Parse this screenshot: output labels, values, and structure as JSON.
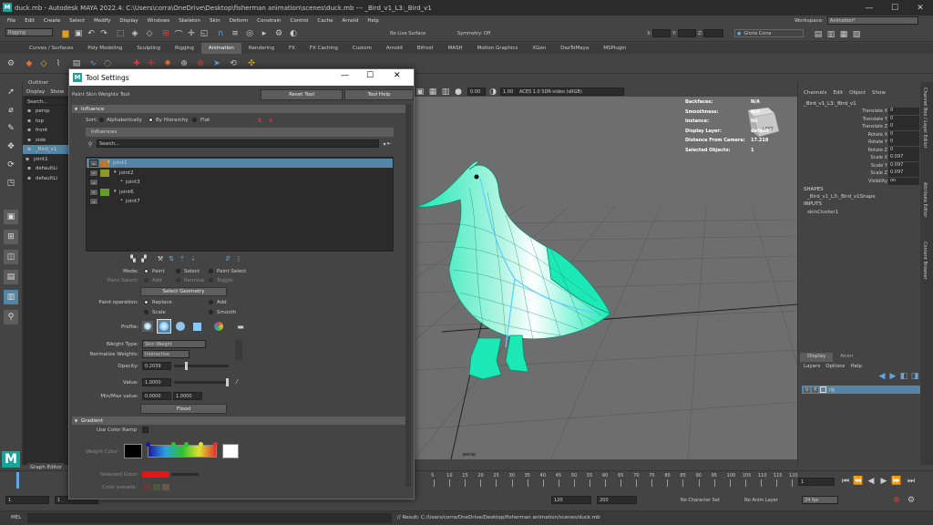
{
  "window": {
    "title": "duck.mb - Autodesk MAYA 2022.4: C:\\Users\\corra\\OneDrive\\Desktop\\fisherman animation\\scenes\\duck.mb  ---  _Bird_v1_L3:_Bird_v1",
    "minimize": "—",
    "maximize": "☐",
    "close": "✕"
  },
  "menubar": [
    "File",
    "Edit",
    "Create",
    "Select",
    "Modify",
    "Display",
    "Windows",
    "Skeleton",
    "Skin",
    "Deform",
    "Constrain",
    "Control",
    "Cache",
    "Arnold",
    "Help"
  ],
  "workspace": {
    "label": "Workspace:",
    "value": "Animation*"
  },
  "statusline": {
    "menuset": "Rigging",
    "live_surface": "No Live Surface",
    "symmetry": "Symmetry: Off",
    "coord_x": "X:",
    "coord_y": "Y:",
    "coord_z": "Z:",
    "user": "Gloria Corra"
  },
  "shelf_tabs": [
    "Curves / Surfaces",
    "Poly Modeling",
    "Sculpting",
    "Rigging",
    "Animation",
    "Rendering",
    "FX",
    "FX Caching",
    "Custom",
    "Arnold",
    "Bifrost",
    "MASH",
    "Motion Graphics",
    "XGen",
    "DazToMaya",
    "MSPlugin"
  ],
  "active_shelf_tab": "Animation",
  "outliner": {
    "title": "Outliner",
    "menu": [
      "Display",
      "Show"
    ],
    "search": "Search...",
    "items": [
      "persp",
      "top",
      "front",
      "side",
      "_Bird_v1",
      "joint1",
      "defaultLi",
      "defaultLi"
    ]
  },
  "tool_settings": {
    "title": "Tool Settings",
    "tool_name": "Paint Skin Weights Tool",
    "reset_tool": "Reset Tool",
    "tool_help": "Tool Help",
    "influence": {
      "header": "Influence",
      "sort_label": "Sort:",
      "sort_options": [
        "Alphabetically",
        "By Hierarchy",
        "Flat"
      ],
      "sort_selected": "By Hierarchy",
      "influences_header": "Influences",
      "search_placeholder": "Search...",
      "joints": [
        {
          "name": "joint1",
          "indent": 1,
          "color": "#b87a30",
          "selected": true,
          "expand": "▾"
        },
        {
          "name": "joint2",
          "indent": 2,
          "color": "#8a9a2a",
          "selected": false,
          "expand": "▾"
        },
        {
          "name": "joint3",
          "indent": 3,
          "color": "",
          "selected": false,
          "expand": "•"
        },
        {
          "name": "joint6",
          "indent": 2,
          "color": "#6a9a2a",
          "selected": false,
          "expand": "▾"
        },
        {
          "name": "joint7",
          "indent": 3,
          "color": "",
          "selected": false,
          "expand": "•"
        }
      ]
    },
    "mode": {
      "label": "Mode:",
      "options": [
        "Paint",
        "Select",
        "Paint Select"
      ],
      "selected": "Paint"
    },
    "paint_select": {
      "label": "Paint Select:",
      "options": [
        "Add",
        "Remove",
        "Toggle"
      ]
    },
    "select_geometry": "Select Geometry",
    "paint_operation": {
      "label": "Paint operation:",
      "options": [
        "Replace",
        "Add",
        "Scale",
        "Smooth"
      ],
      "selected": "Replace"
    },
    "profile_label": "Profile:",
    "weight_type": {
      "label": "Weight Type:",
      "value": "Skin Weight"
    },
    "normalize_weights": {
      "label": "Normalize Weights:",
      "value": "Interactive"
    },
    "opacity": {
      "label": "Opacity:",
      "value": "0.2039",
      "fraction": 0.2039
    },
    "value": {
      "label": "Value:",
      "value": "1.0000",
      "fraction": 1.0
    },
    "minmax": {
      "label": "Min/Max value:",
      "min": "0.0000",
      "max": "1.0000"
    },
    "flood": "Flood",
    "gradient": {
      "header": "Gradient",
      "use_color_ramp": "Use Color Ramp",
      "weight_color": "Weight Color:",
      "selected_color": "Selected Color:",
      "color_presets": "Color presets:"
    }
  },
  "panel": {
    "zoom": "0.00",
    "scale": "1.00",
    "colorspace": "ACES 1.0 SDR-video (sRGB)"
  },
  "hud": [
    {
      "label": "Backfaces:",
      "value": "N/A"
    },
    {
      "label": "Smoothness:",
      "value": "N/A"
    },
    {
      "label": "Instance:",
      "value": "No"
    },
    {
      "label": "Display Layer:",
      "value": "default"
    },
    {
      "label": "Distance From Camera:",
      "value": "17.218"
    },
    {
      "label": "Selected Objects:",
      "value": "1"
    }
  ],
  "viewcube_label": "LEFT",
  "camera_label": "persp",
  "channel_box": {
    "tabs": [
      "Channels",
      "Edit",
      "Object",
      "Show"
    ],
    "object": "_Bird_v1_L3:_Bird_v1",
    "attrs": [
      {
        "name": "Translate X",
        "value": "0"
      },
      {
        "name": "Translate Y",
        "value": "0"
      },
      {
        "name": "Translate Z",
        "value": "0"
      },
      {
        "name": "Rotate X",
        "value": "0"
      },
      {
        "name": "Rotate Y",
        "value": "0"
      },
      {
        "name": "Rotate Z",
        "value": "0"
      },
      {
        "name": "Scale X",
        "value": "0.097"
      },
      {
        "name": "Scale Y",
        "value": "0.097"
      },
      {
        "name": "Scale Z",
        "value": "0.097"
      },
      {
        "name": "Visibility",
        "value": "on"
      }
    ],
    "shapes_header": "SHAPES",
    "shape": "_Bird_v1_L3:_Bird_v1Shape",
    "inputs_header": "INPUTS",
    "input": "skinCluster1"
  },
  "layer_editor": {
    "tabs": [
      "Display",
      "Anim"
    ],
    "menu": [
      "Layers",
      "Options",
      "Help"
    ],
    "layer": {
      "v": "V",
      "p": "P",
      "name": "rig"
    }
  },
  "side_tabs": [
    "Channel Box / Layer Editor",
    "Attribute Editor",
    "Content Browser"
  ],
  "timeline": {
    "ticks": [
      "5",
      "10",
      "15",
      "20",
      "25",
      "30",
      "35",
      "40",
      "45",
      "50",
      "55",
      "60",
      "65",
      "70",
      "75",
      "80",
      "85",
      "90",
      "95",
      "100",
      "105",
      "110",
      "115",
      "120"
    ],
    "current": "1"
  },
  "range": {
    "start": "1",
    "inner_start": "1",
    "inner_end": "120",
    "end": "200",
    "character_set": "No Character Set",
    "anim_layer": "No Anim Layer",
    "fps": "24 fps"
  },
  "graph_editor": "Graph Editor",
  "cmd": {
    "lang": "MEL",
    "result": "// Result: C:/Users/corra/OneDrive/Desktop/fisherman animation/scenes/duck.mb"
  }
}
